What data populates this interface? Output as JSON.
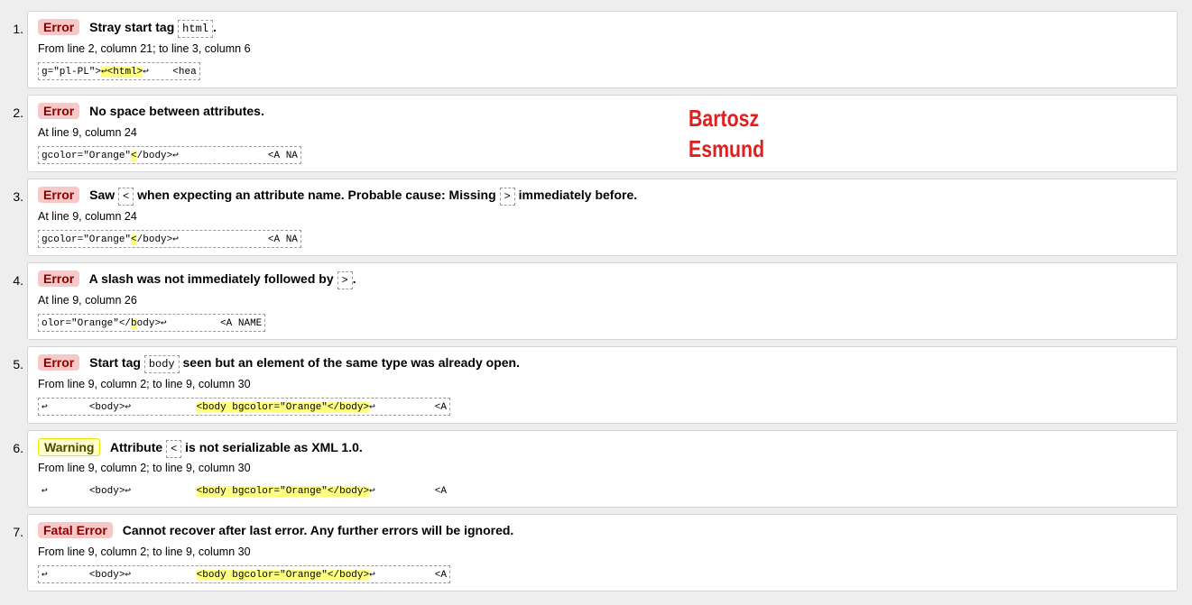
{
  "messages": [
    {
      "num": "1.",
      "type": "Error",
      "msg_pre": "Stray start tag",
      "code1": "html",
      "msg_post": ".",
      "location": "From line 2, column 21; to line 3, column 6",
      "ext_pre": "g=\"pl-PL\">",
      "ext_hl": "↩<html>",
      "ext_post": "↩    <hea"
    },
    {
      "num": "2.",
      "type": "Error",
      "msg_pre": "No space between attributes.",
      "location": "At line 9, column 24",
      "ext_pre": "gcolor=\"Orange\"",
      "ext_hl": "<",
      "ext_post": "/body>↩               <A NA"
    },
    {
      "num": "3.",
      "type": "Error",
      "msg_pre": "Saw",
      "code1": "<",
      "msg_mid": "when expecting an attribute name. Probable cause: Missing",
      "code2": ">",
      "msg_post": "immediately before.",
      "location": "At line 9, column 24",
      "ext_pre": "gcolor=\"Orange\"",
      "ext_hl": "<",
      "ext_post": "/body>↩               <A NA"
    },
    {
      "num": "4.",
      "type": "Error",
      "msg_pre": "A slash was not immediately followed by",
      "code1": ">",
      "msg_post": ".",
      "location": "At line 9, column 26",
      "ext_pre": "olor=\"Orange\"</",
      "ext_hl": "b",
      "ext_post": "ody>↩         <A NAME"
    },
    {
      "num": "5.",
      "type": "Error",
      "msg_pre": "Start tag",
      "code1": "body",
      "msg_post": "seen but an element of the same type was already open.",
      "location": "From line 9, column 2; to line 9, column 30",
      "ext_pre": "↩       <body>↩           ",
      "ext_hl": "<body bgcolor=\"Orange\"</body>",
      "ext_post": "↩          <A"
    },
    {
      "num": "6.",
      "type": "Warning",
      "msg_pre": "Attribute",
      "code1": "<",
      "msg_post": "is not serializable as XML 1.0.",
      "location": "From line 9, column 2; to line 9, column 30",
      "ext_pre": "↩       <body>↩           ",
      "ext_hl": "<body bgcolor=\"Orange\"</body>",
      "ext_post": "↩          <A"
    },
    {
      "num": "7.",
      "type": "Fatal Error",
      "msg_pre": "Cannot recover after last error. Any further errors will be ignored.",
      "location": "From line 9, column 2; to line 9, column 30",
      "ext_pre": "↩       <body>↩           ",
      "ext_hl": "<body bgcolor=\"Orange\"</body>",
      "ext_post": "↩          <A"
    }
  ],
  "signature": {
    "line1": "Bartosz",
    "line2": "Esmund",
    "color": "#e02020"
  }
}
